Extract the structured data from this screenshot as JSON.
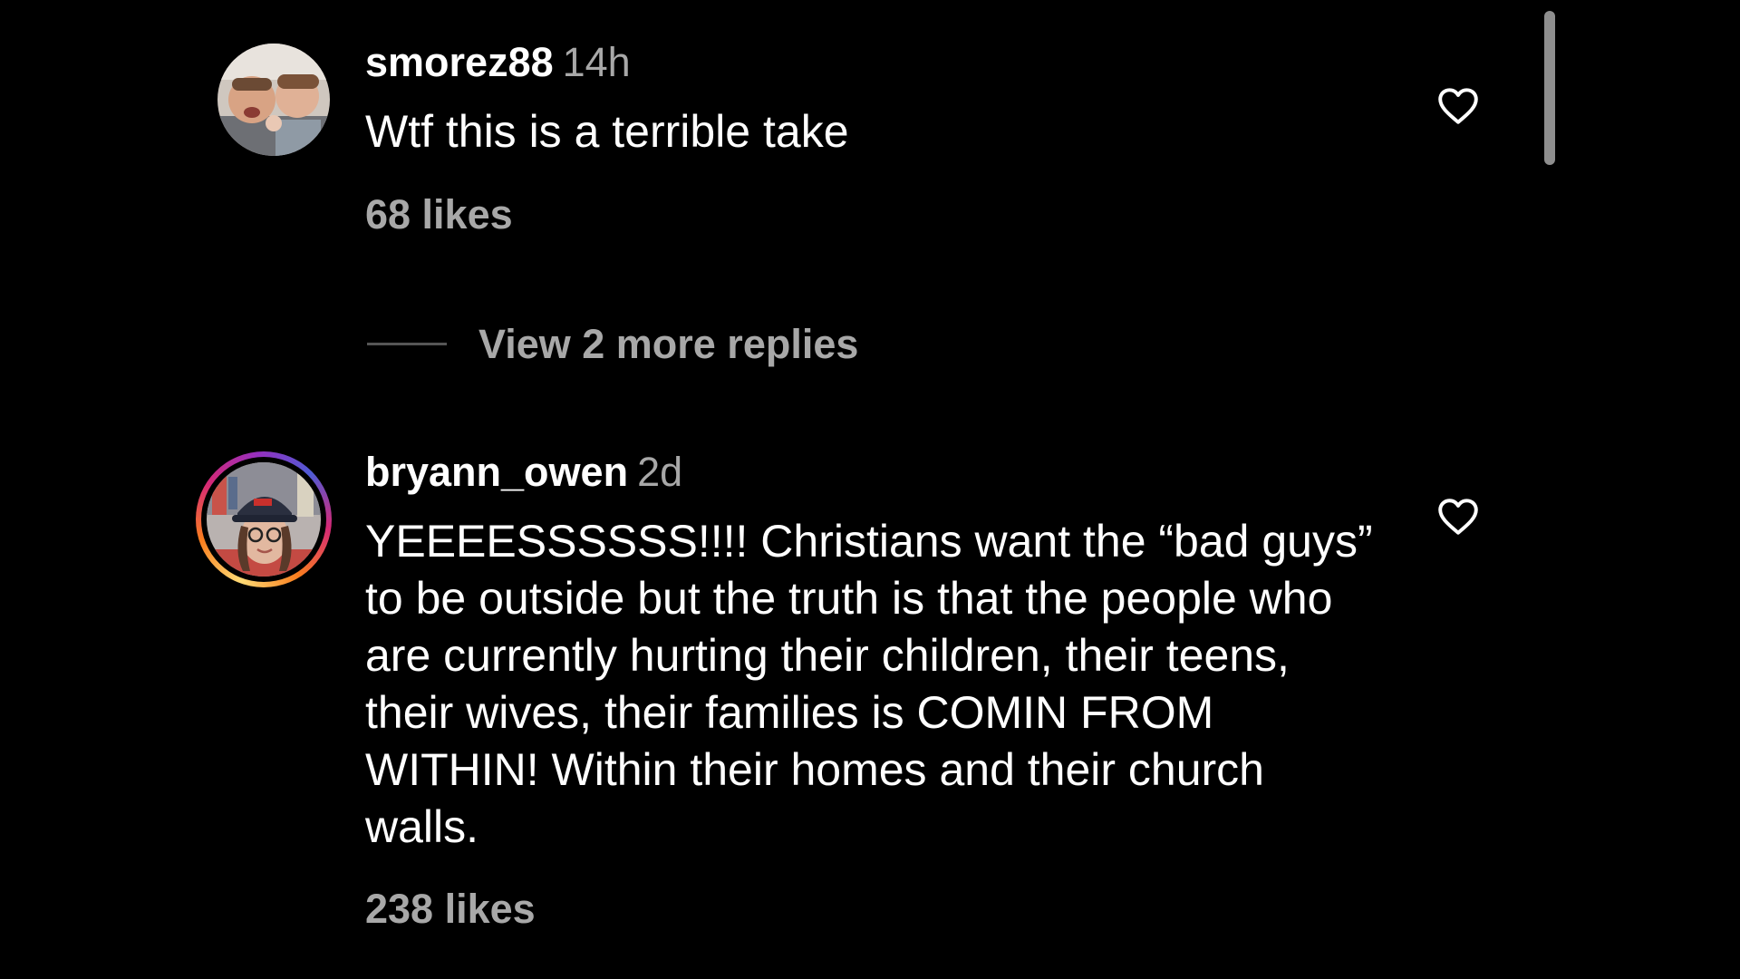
{
  "comments": [
    {
      "username": "smorez88",
      "time": "14h",
      "text": "Wtf this is a terrible take",
      "likes": "68 likes",
      "avatar": "two-men-selfie-avatar"
    },
    {
      "username": "bryann_owen",
      "time": "2d",
      "text": "YEEEESSSSSS!!!! Christians want the “bad guys” to be outside but the truth is that the people who are currently hurting their children, their teens, their wives, their families is COMIN FROM WITHIN! Within their homes and their church walls.",
      "likes": "238 likes",
      "avatar": "woman-with-cap-and-glasses-avatar",
      "has_story_ring": true
    }
  ],
  "replies": {
    "label": "View 2 more replies"
  },
  "icons": {
    "like": "heart-outline-icon"
  },
  "colors": {
    "background": "#000000",
    "primary_text": "#ffffff",
    "secondary_text": "#a8a8a8",
    "story_ring_start": "#feda75",
    "story_ring_mid": "#d62976",
    "story_ring_end": "#962fbf"
  }
}
